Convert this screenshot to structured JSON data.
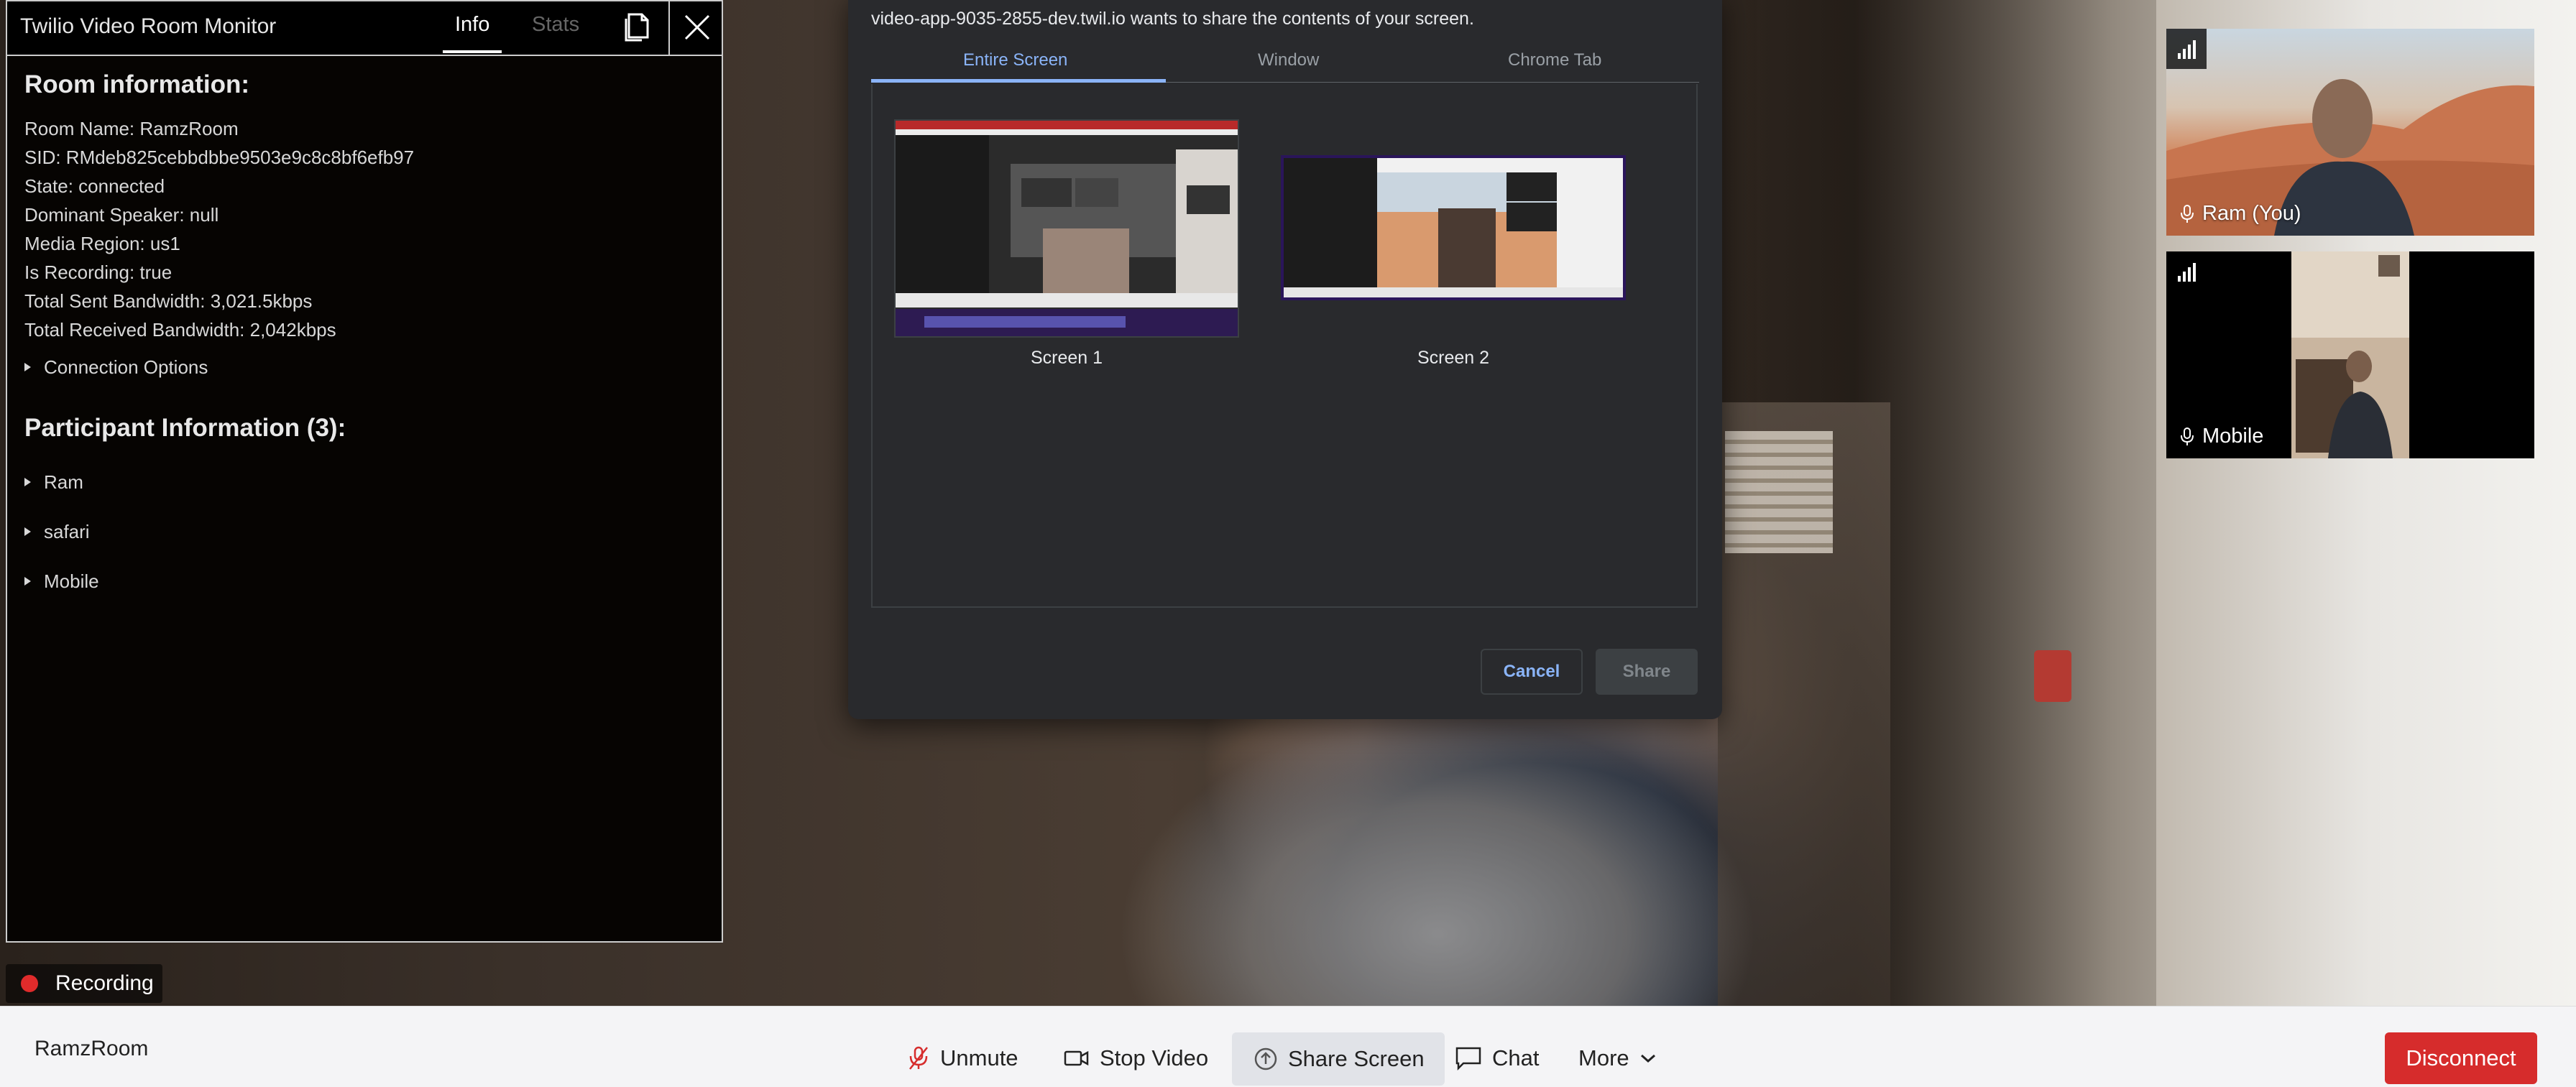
{
  "monitor": {
    "title": "Twilio Video Room Monitor",
    "tabs": {
      "info": "Info",
      "stats": "Stats"
    },
    "room_section_title": "Room information:",
    "room_info": [
      "Room Name: RamzRoom",
      "SID: RMdeb825cebbdbbe9503e9c8c8bf6efb97",
      "State: connected",
      "Dominant Speaker: null",
      "Media Region: us1",
      "Is Recording: true",
      "Total Sent Bandwidth: 3,021.5kbps",
      "Total Received Bandwidth: 2,042kbps"
    ],
    "connection_options": "Connection Options",
    "participant_section_title": "Participant Information (3):",
    "participants": [
      "Ram",
      "safari",
      "Mobile"
    ]
  },
  "recording": {
    "label": "Recording",
    "color": "#e02b2b"
  },
  "share_dialog": {
    "message": "video-app-9035-2855-dev.twil.io wants to share the contents of your screen.",
    "tabs": [
      "Entire Screen",
      "Window",
      "Chrome Tab"
    ],
    "active_tab": "Entire Screen",
    "screens": [
      "Screen 1",
      "Screen 2"
    ],
    "cancel_label": "Cancel",
    "share_label": "Share",
    "accent": "#8ab4f8"
  },
  "tiles": [
    {
      "name": "Ram (You)"
    },
    {
      "name": "Mobile"
    }
  ],
  "toolbar": {
    "room_name": "RamzRoom",
    "unmute": "Unmute",
    "stop_video": "Stop Video",
    "share_screen": "Share Screen",
    "chat": "Chat",
    "more": "More",
    "disconnect": "Disconnect",
    "disconnect_color": "#d62c2c"
  }
}
